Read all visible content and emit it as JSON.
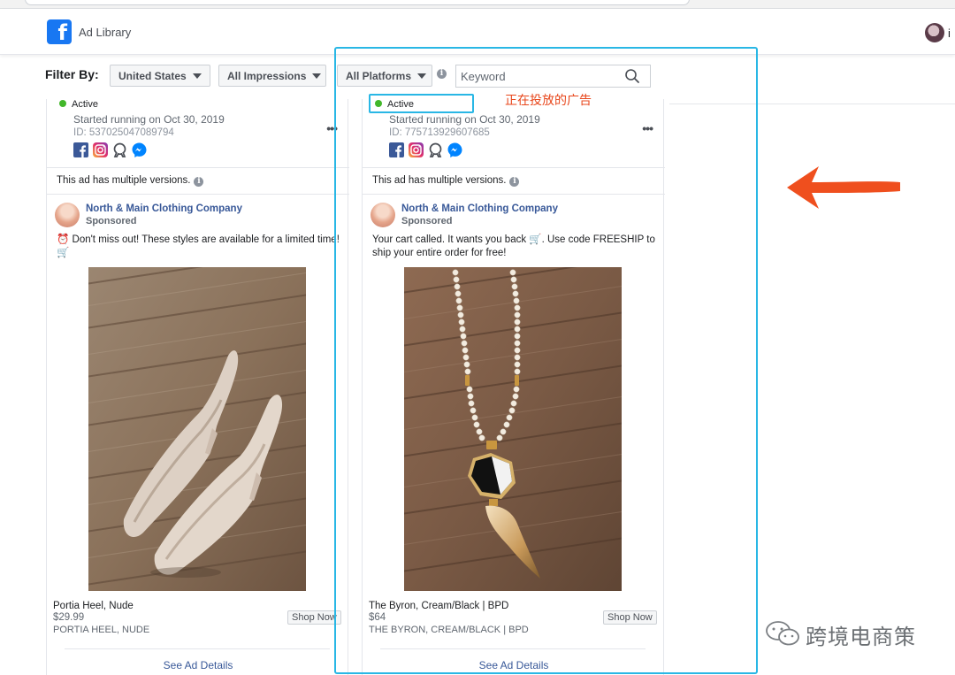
{
  "header": {
    "title": "Ad Library",
    "profile_initial": "i"
  },
  "filters": {
    "label": "Filter By:",
    "country": "United States",
    "impressions": "All Impressions",
    "platforms": "All Platforms",
    "keyword_placeholder": "Keyword",
    "info_glyph": "i"
  },
  "ads": [
    {
      "status": "Active",
      "started": "Started running on Oct 30, 2019",
      "id": "ID: 537025047089794",
      "more": "•••",
      "platform_icons": [
        "facebook-icon",
        "instagram-icon",
        "audience-network-icon",
        "messenger-icon"
      ],
      "multiple_versions": "This ad has multiple versions.",
      "advertiser": "North & Main Clothing Company",
      "sponsored": "Sponsored",
      "copy": "⏰ Don't miss out! These styles are available for a limited time! 🛒",
      "product_name": "Portia Heel, Nude",
      "price": "$29.99",
      "product_caps": "PORTIA HEEL, NUDE",
      "shop_now": "Shop Now",
      "see_details": "See Ad Details"
    },
    {
      "status": "Active",
      "started": "Started running on Oct 30, 2019",
      "id": "ID: 775713929607685",
      "more": "•••",
      "platform_icons": [
        "facebook-icon",
        "instagram-icon",
        "audience-network-icon",
        "messenger-icon"
      ],
      "multiple_versions": "This ad has multiple versions.",
      "advertiser": "North & Main Clothing Company",
      "sponsored": "Sponsored",
      "copy": "Your cart called. It wants you back 🛒. Use code FREESHIP to ship your entire order for free!",
      "product_name": "The Byron, Cream/Black | BPD",
      "price": "$64",
      "product_caps": "THE BYRON, CREAM/BLACK | BPD",
      "shop_now": "Shop Now",
      "see_details": "See Ad Details"
    }
  ],
  "annotation": {
    "label": "正在投放的广告",
    "color": "#e8471c",
    "box_color": "#29b7e5"
  },
  "watermark": {
    "text": "跨境电商策"
  },
  "colors": {
    "brand": "#1877f2",
    "link": "#385898",
    "active": "#42b72a"
  }
}
